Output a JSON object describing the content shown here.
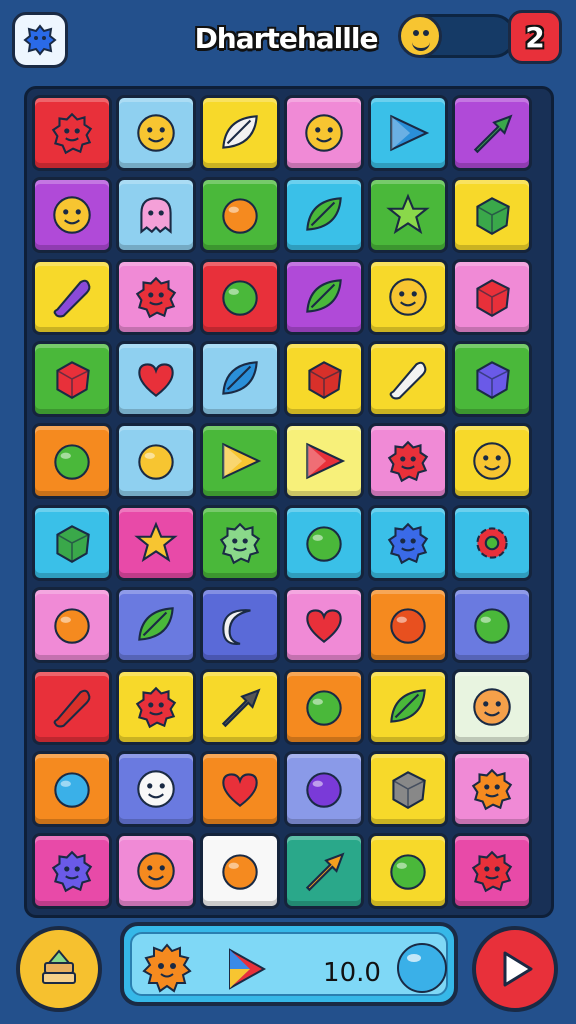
{
  "header": {
    "title": "Dhartehallle",
    "counter": "2",
    "settings_icon": "blue-splat-icon",
    "progress_icon": "smiley-face-icon"
  },
  "board": {
    "rows": 10,
    "cols": 6,
    "tiles": [
      {
        "bg": "#e8303a",
        "icon": "red-blob-monster",
        "shape": "blob",
        "color": "#e8303a"
      },
      {
        "bg": "#8fd0f0",
        "icon": "yellow-cat-face",
        "shape": "face",
        "color": "#f7c531"
      },
      {
        "bg": "#f7d92a",
        "icon": "white-compass-leaf",
        "shape": "leaf",
        "color": "#f2f2f2"
      },
      {
        "bg": "#f08ad6",
        "icon": "yellow-smiley",
        "shape": "face",
        "color": "#f7c531"
      },
      {
        "bg": "#3ac0e8",
        "icon": "blue-paper-plane",
        "shape": "triangle",
        "color": "#2a8fd8"
      },
      {
        "bg": "#b04ad8",
        "icon": "green-arrow",
        "shape": "arrow",
        "color": "#3aa84a"
      },
      {
        "bg": "#b04ad8",
        "icon": "yellow-lion-face",
        "shape": "face",
        "color": "#f7c531"
      },
      {
        "bg": "#8fd0f0",
        "icon": "pink-ghost",
        "shape": "ghost",
        "color": "#f4a0d8"
      },
      {
        "bg": "#4ab83a",
        "icon": "orange-speech-bubble",
        "shape": "circle",
        "color": "#f58a1f"
      },
      {
        "bg": "#3ac0e8",
        "icon": "green-leaf-shield",
        "shape": "leaf",
        "color": "#4ab83a"
      },
      {
        "bg": "#4ab83a",
        "icon": "green-star",
        "shape": "star",
        "color": "#8ad84a"
      },
      {
        "bg": "#f7d92a",
        "icon": "green-gem",
        "shape": "gem",
        "color": "#3aa84a"
      },
      {
        "bg": "#f7d92a",
        "icon": "purple-crayon",
        "shape": "pill",
        "color": "#8a4ad8"
      },
      {
        "bg": "#f08ad6",
        "icon": "red-devil-face",
        "shape": "blob",
        "color": "#e8303a"
      },
      {
        "bg": "#e8303a",
        "icon": "green-blob",
        "shape": "circle",
        "color": "#4ab83a"
      },
      {
        "bg": "#b04ad8",
        "icon": "green-sprout",
        "shape": "leaf",
        "color": "#4ab83a"
      },
      {
        "bg": "#f7d92a",
        "icon": "yellow-chick",
        "shape": "face",
        "color": "#f7c531"
      },
      {
        "bg": "#f08ad6",
        "icon": "red-rock",
        "shape": "gem",
        "color": "#e8303a"
      },
      {
        "bg": "#4ab83a",
        "icon": "cube-icon",
        "shape": "gem",
        "color": "#e8303a"
      },
      {
        "bg": "#8fd0f0",
        "icon": "red-heart",
        "shape": "heart",
        "color": "#e8303a"
      },
      {
        "bg": "#8fd0f0",
        "icon": "blue-leaf",
        "shape": "leaf",
        "color": "#2a8fd8"
      },
      {
        "bg": "#f7d92a",
        "icon": "red-box",
        "shape": "gem",
        "color": "#d8302a"
      },
      {
        "bg": "#f7d92a",
        "icon": "eraser-icon",
        "shape": "pill",
        "color": "#f2f2f2"
      },
      {
        "bg": "#4ab83a",
        "icon": "blue-gem",
        "shape": "gem",
        "color": "#6a5ae8"
      },
      {
        "bg": "#f58a1f",
        "icon": "green-blob",
        "shape": "circle",
        "color": "#4ab83a"
      },
      {
        "bg": "#8fd0f0",
        "icon": "yellow-fish",
        "shape": "circle",
        "color": "#f7c531"
      },
      {
        "bg": "#4ab83a",
        "icon": "yellow-cheese",
        "shape": "triangle",
        "color": "#f7c531"
      },
      {
        "bg": "#f7f07a",
        "icon": "colorful-triangle",
        "shape": "triangle",
        "color": "#e8303a"
      },
      {
        "bg": "#f08ad6",
        "icon": "red-crab",
        "shape": "blob",
        "color": "#e8303a"
      },
      {
        "bg": "#f7d92a",
        "icon": "yellow-face",
        "shape": "face",
        "color": "#f7c531"
      },
      {
        "bg": "#3ac0e8",
        "icon": "green-pinwheel",
        "shape": "gem",
        "color": "#3aa84a"
      },
      {
        "bg": "#e84aa8",
        "icon": "yellow-star",
        "shape": "star",
        "color": "#f7c531"
      },
      {
        "bg": "#4ab83a",
        "icon": "green-gear-blob",
        "shape": "blob",
        "color": "#8ad88a"
      },
      {
        "bg": "#3ac0e8",
        "icon": "green-apple",
        "shape": "circle",
        "color": "#4ab83a"
      },
      {
        "bg": "#3ac0e8",
        "icon": "blue-puffball",
        "shape": "blob",
        "color": "#3a6ae8"
      },
      {
        "bg": "#3ac0e8",
        "icon": "red-gear",
        "shape": "gear",
        "color": "#e8303a"
      },
      {
        "bg": "#f08ad6",
        "icon": "orange-chick",
        "shape": "circle",
        "color": "#f58a1f"
      },
      {
        "bg": "#6a7ae0",
        "icon": "green-hook",
        "shape": "leaf",
        "color": "#4ab83a"
      },
      {
        "bg": "#5a6ad8",
        "icon": "white-moon",
        "shape": "moon",
        "color": "#f2f2f2"
      },
      {
        "bg": "#f08ad6",
        "icon": "red-apple",
        "shape": "heart",
        "color": "#e8303a"
      },
      {
        "bg": "#f58a1f",
        "icon": "orange-ball",
        "shape": "circle",
        "color": "#e8501f"
      },
      {
        "bg": "#6a7ae0",
        "icon": "green-check",
        "shape": "circle",
        "color": "#4ab83a"
      },
      {
        "bg": "#e8303a",
        "icon": "red-eraser",
        "shape": "pill",
        "color": "#d8302a"
      },
      {
        "bg": "#f7d92a",
        "icon": "red-blob",
        "shape": "blob",
        "color": "#e8303a"
      },
      {
        "bg": "#f7d92a",
        "icon": "sword-frame",
        "shape": "arrow",
        "color": "#555555"
      },
      {
        "bg": "#f58a1f",
        "icon": "green-ball",
        "shape": "circle",
        "color": "#4ab83a"
      },
      {
        "bg": "#f7d92a",
        "icon": "green-leaf",
        "shape": "leaf",
        "color": "#4ab83a"
      },
      {
        "bg": "#e8f4e0",
        "icon": "monkey-face",
        "shape": "face",
        "color": "#f5a04a"
      },
      {
        "bg": "#f58a1f",
        "icon": "blue-fish",
        "shape": "circle",
        "color": "#3ab0e8"
      },
      {
        "bg": "#6a7ae0",
        "icon": "white-ghost",
        "shape": "face",
        "color": "#f8f8f8"
      },
      {
        "bg": "#f58a1f",
        "icon": "red-heart",
        "shape": "heart",
        "color": "#e8303a"
      },
      {
        "bg": "#8a9ae8",
        "icon": "purple-plum",
        "shape": "circle",
        "color": "#7a3ad8"
      },
      {
        "bg": "#f7d92a",
        "icon": "grey-radio",
        "shape": "gem",
        "color": "#888888"
      },
      {
        "bg": "#f08ad6",
        "icon": "orange-blob",
        "shape": "blob",
        "color": "#f58a1f"
      },
      {
        "bg": "#e84aa8",
        "icon": "purple-monster",
        "shape": "blob",
        "color": "#6a5ae8"
      },
      {
        "bg": "#f08ad6",
        "icon": "orange-lion",
        "shape": "face",
        "color": "#f58a1f"
      },
      {
        "bg": "#f8f8f8",
        "icon": "orange-lollipop",
        "shape": "circle",
        "color": "#f58a1f"
      },
      {
        "bg": "#2aa88a",
        "icon": "orange-carrot",
        "shape": "arrow",
        "color": "#f5a01f"
      },
      {
        "bg": "#f7d92a",
        "icon": "green-bubble",
        "shape": "circle",
        "color": "#4ab83a"
      },
      {
        "bg": "#e84aa8",
        "icon": "red-bug",
        "shape": "blob",
        "color": "#e8303a"
      }
    ]
  },
  "footer": {
    "stack_icon": "stacked-blocks-icon",
    "score": "10.0",
    "left_icon": "orange-lion-icon",
    "middle_icon": "play-triangle-icon",
    "right_icon": "blue-bubble-icon",
    "play_icon": "play-icon"
  }
}
